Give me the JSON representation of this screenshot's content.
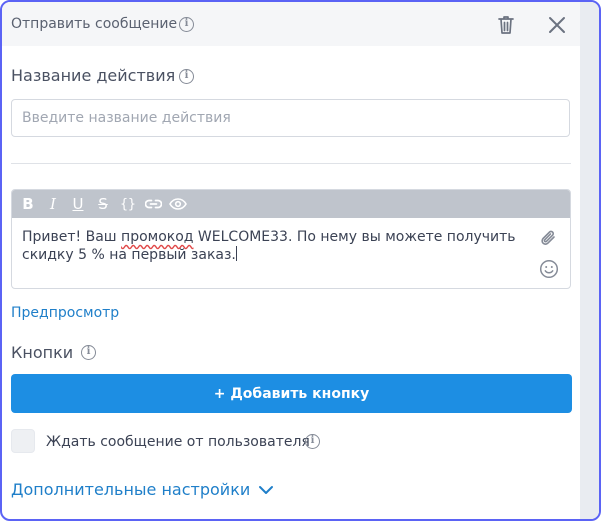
{
  "header": {
    "title": "Отправить сообщение",
    "info_icon": "info-icon",
    "delete_icon": "trash-icon",
    "close_icon": "close-icon"
  },
  "action_name": {
    "label": "Название действия",
    "placeholder": "Введите название действия",
    "value": ""
  },
  "editor": {
    "toolbar": [
      {
        "name": "bold-button",
        "glyph": "B"
      },
      {
        "name": "italic-button",
        "glyph": "I"
      },
      {
        "name": "underline-button",
        "glyph": "U"
      },
      {
        "name": "strikethrough-button",
        "glyph": "S"
      },
      {
        "name": "code-button",
        "glyph": "{}"
      },
      {
        "name": "link-button",
        "glyph": "link-icon"
      },
      {
        "name": "preview-toggle-button",
        "glyph": "eye-icon"
      }
    ],
    "message": {
      "part1": "Привет! Ваш ",
      "misspelled": "промокод",
      "part2": " WELCOME33. По нему вы можете получить скидку 5 % на первый заказ."
    },
    "attach_icon": "paperclip-icon",
    "emoji_icon": "smiley-icon"
  },
  "preview_link": "Предпросмотр",
  "buttons_section": {
    "label": "Кнопки",
    "add_button": "+ Добавить кнопку"
  },
  "wait_reply": {
    "label": "Ждать сообщение от пользователя",
    "checked": false
  },
  "advanced_settings": {
    "label": "Дополнительные настройки",
    "icon": "chevron-down-icon"
  },
  "colors": {
    "accent": "#1d8ee3",
    "link": "#1f7fc9",
    "focus_border": "#5b63f5",
    "toolbar": "#bfc4cc"
  }
}
